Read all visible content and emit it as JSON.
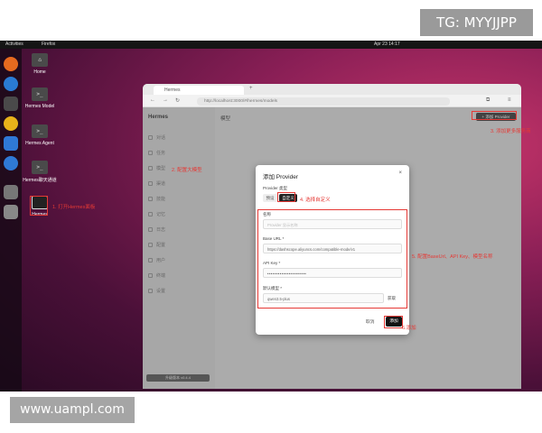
{
  "watermarks": {
    "top": "TG: MYYJJPP",
    "bottom": "www.uampl.com"
  },
  "topbar": {
    "activities": "Activities",
    "app": "Firefox",
    "clock": "Apr 23 14:17"
  },
  "desktop_icons": [
    {
      "label": "Home",
      "glyph": "⌂"
    },
    {
      "label": "Hermes Model",
      "glyph": ">_"
    },
    {
      "label": "Hermes Agent",
      "glyph": ">_"
    },
    {
      "label": "Hermes聊天通道",
      "glyph": ">_"
    },
    {
      "label": "Hermes",
      "glyph": ""
    }
  ],
  "browser": {
    "tab_title": "Hermes",
    "url": "http://localhost:3000/#/hermes/models"
  },
  "app": {
    "brand": "Hermes",
    "page_title": "模型",
    "add_provider_label": "+ 添加 Provider",
    "sidebar_items": [
      "对话",
      "任务",
      "模型",
      "渠道",
      "技能",
      "记忆",
      "日志",
      "配置",
      "用户",
      "终端",
      "设置"
    ],
    "version_label": "升级版本 v0.4.4"
  },
  "annotations": {
    "step1": "1. 打开Hermes面板",
    "step2": "2. 配置大模型",
    "step3": "3. 添加更多服务商",
    "step4": "4. 选择自定义",
    "step5": "5. 配置BaseUrl、API Key、模型名称",
    "step6": "6.添加"
  },
  "modal": {
    "title": "添加 Provider",
    "close_symbol": "×",
    "type_label": "Provider 类型",
    "type_options": [
      "预设",
      "自定义"
    ],
    "name_label": "名称",
    "name_placeholder": "Provider 显示名称",
    "base_url_label": "Base URL *",
    "base_url_value": "https://dashscope.aliyuncs.com/compatible-mode/v1",
    "api_key_label": "API Key *",
    "api_key_value": "••••••••••••••••••••••",
    "model_label": "默认模型 *",
    "model_value": "qwen3.5-plus",
    "fetch_label": "获取",
    "cancel_label": "取消",
    "add_label": "添加"
  },
  "colors": {
    "annotation": "#e53935",
    "wallpaper_accent": "#c8356a"
  }
}
